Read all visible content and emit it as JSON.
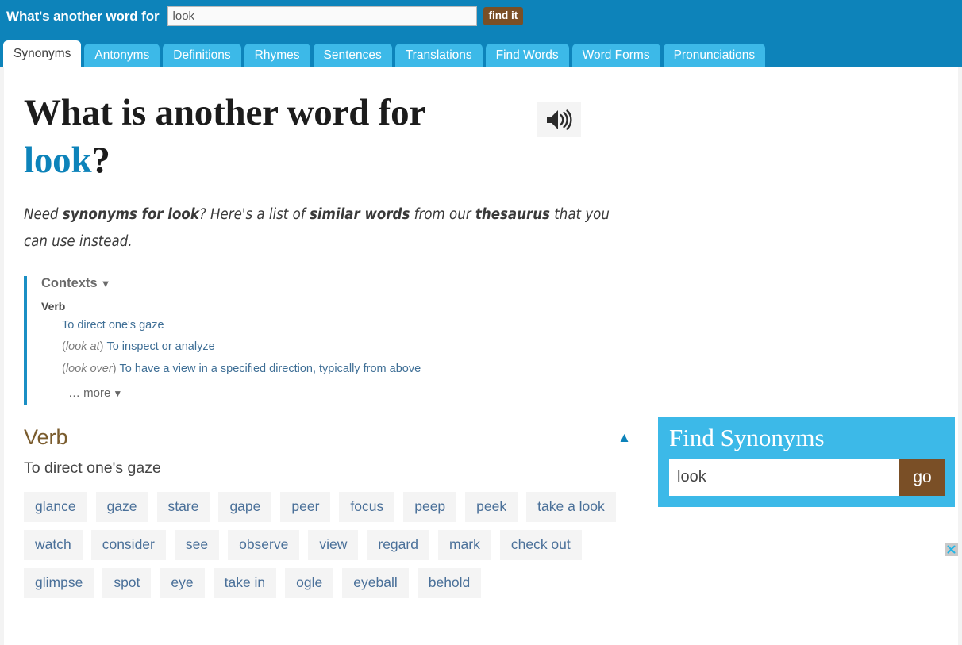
{
  "header": {
    "label": "What's another word for",
    "search_value": "look",
    "search_placeholder": "",
    "find_button": "find it",
    "tabs": [
      {
        "label": "Synonyms",
        "active": true
      },
      {
        "label": "Antonyms",
        "active": false
      },
      {
        "label": "Definitions",
        "active": false
      },
      {
        "label": "Rhymes",
        "active": false
      },
      {
        "label": "Sentences",
        "active": false
      },
      {
        "label": "Translations",
        "active": false
      },
      {
        "label": "Find Words",
        "active": false
      },
      {
        "label": "Word Forms",
        "active": false
      },
      {
        "label": "Pronunciations",
        "active": false
      }
    ]
  },
  "main": {
    "headline_prefix": "What is another word for",
    "headline_word": "look",
    "headline_suffix": "?",
    "speaker_icon": "speaker-icon",
    "intro": {
      "part1": "Need ",
      "bold1": "synonyms for look",
      "part2": "? Here's a list of ",
      "bold2": "similar words",
      "part3": " from our ",
      "bold3": "thesaurus",
      "part4": " that you can use instead."
    },
    "contexts": {
      "heading": "Contexts",
      "caret": "▼",
      "pos": "Verb",
      "items": [
        {
          "qualifier": "",
          "text": "To direct one's gaze"
        },
        {
          "qualifier": "look at",
          "text": "To inspect or analyze"
        },
        {
          "qualifier": "look over",
          "text": "To have a view in a specified direction, typically from above"
        }
      ],
      "more_label": "… more",
      "more_caret": "▼"
    },
    "verb_section": {
      "title": "Verb",
      "collapse_icon": "▲",
      "definition": "To direct one's gaze",
      "synonyms": [
        "glance",
        "gaze",
        "stare",
        "gape",
        "peer",
        "focus",
        "peep",
        "peek",
        "take a look",
        "watch",
        "consider",
        "see",
        "observe",
        "view",
        "regard",
        "mark",
        "check out",
        "glimpse",
        "spot",
        "eye",
        "take in",
        "ogle",
        "eyeball",
        "behold"
      ]
    }
  },
  "sidebar": {
    "find_box": {
      "title": "Find Synonyms",
      "input_value": "look",
      "input_placeholder": "",
      "go_label": "go"
    },
    "close_icon": "close-icon"
  },
  "colors": {
    "header_blue": "#0d83ba",
    "tab_blue": "#3cb9e8",
    "brown": "#7a4f26",
    "link_blue": "#3f6f96",
    "chip_bg": "#f4f4f4",
    "verb_brown": "#7a5c2e"
  }
}
